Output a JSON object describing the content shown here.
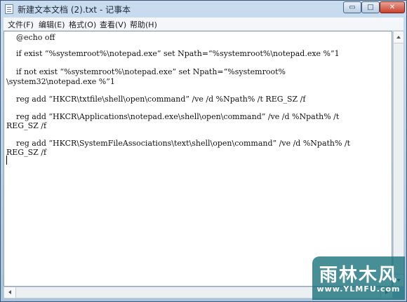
{
  "window": {
    "title": "新建文本文档 (2).txt - 记事本",
    "controls": {
      "minimize": "▭",
      "maximize": "□",
      "close": "✕"
    }
  },
  "menu": [
    "文件(F)",
    "编辑(E)",
    "格式(O)",
    "查看(V)",
    "帮助(H)"
  ],
  "editor": {
    "lines": [
      "    @echo off",
      "",
      "    if exist “%systemroot%\\notepad.exe” set Npath=“%systemroot%\\notepad.exe %”1",
      "",
      "    if not exist “%systemroot%\\notepad.exe” set Npath=“%systemroot%",
      "\\system32\\notepad.exe %”1",
      "",
      "    reg add “HKCR\\txtfile\\shell\\open\\command” /ve /d %Npath% /t REG_SZ /f",
      "",
      "    reg add “HKCR\\Applications\\notepad.exe\\shell\\open\\command” /ve /d %Npath% /t",
      "REG_SZ /f",
      "",
      "    reg add “HKCR\\SystemFileAssociations\\text\\shell\\open\\command” /ve /d %Npath% /t",
      "REG_SZ /f"
    ]
  },
  "watermark": {
    "logo": "雨林木风",
    "url": "www.YLMFU.com"
  }
}
